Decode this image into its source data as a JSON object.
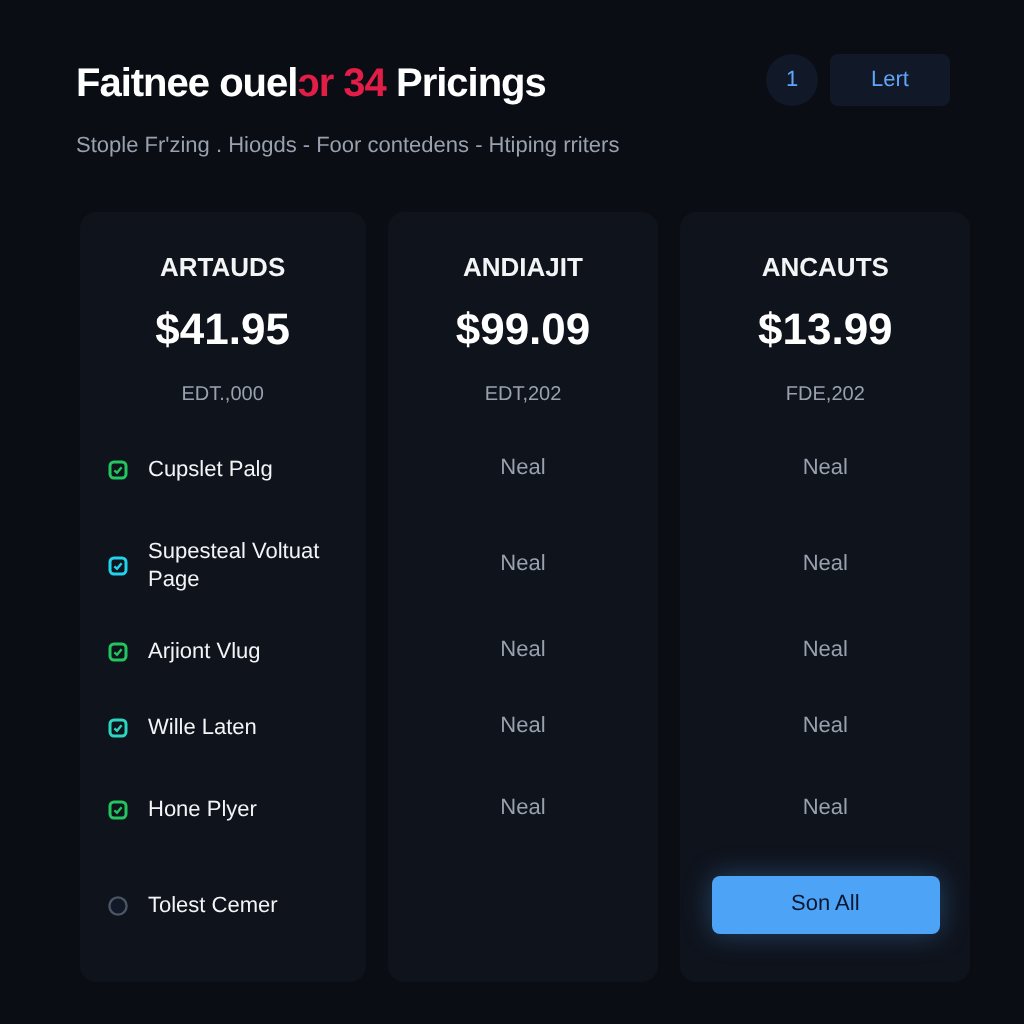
{
  "header": {
    "title_start": "Faitnee ouel",
    "title_highlight": "ɔr 34",
    "title_end": " Pricings",
    "subtitle": "Stople Fr'zing . Hiogds - Foor contedens - Htiping rriters",
    "badge": "1",
    "button": "Lert"
  },
  "plans": [
    {
      "name": "ARTAUDS",
      "price": "$41.95",
      "period": "EDT.,000",
      "features": [
        {
          "label": "Cupslet Palg",
          "checked": true,
          "color": "#22c55e"
        },
        {
          "label": "Supesteal Voltuat Page",
          "checked": true,
          "color": "#22d3ee"
        },
        {
          "label": "Arjiont Vlug",
          "checked": true,
          "color": "#22c55e"
        },
        {
          "label": "Wille Laten",
          "checked": true,
          "color": "#2dd4bf"
        },
        {
          "label": "Hone Plyer",
          "checked": true,
          "color": "#22c55e"
        },
        {
          "label": "Tolest Cemer",
          "checked": false,
          "color": "#4b5563"
        }
      ]
    },
    {
      "name": "ANDIAJIT",
      "price": "$99.09",
      "period": "EDT,202",
      "cells": [
        "Neal",
        "Neal",
        "Neal",
        "Neal",
        "Neal"
      ]
    },
    {
      "name": "ANCAUTS",
      "price": "$13.99",
      "period": "FDE,202",
      "cells": [
        "Neal",
        "Neal",
        "Neal",
        "Neal",
        "Neal"
      ],
      "button": "Son All"
    }
  ]
}
